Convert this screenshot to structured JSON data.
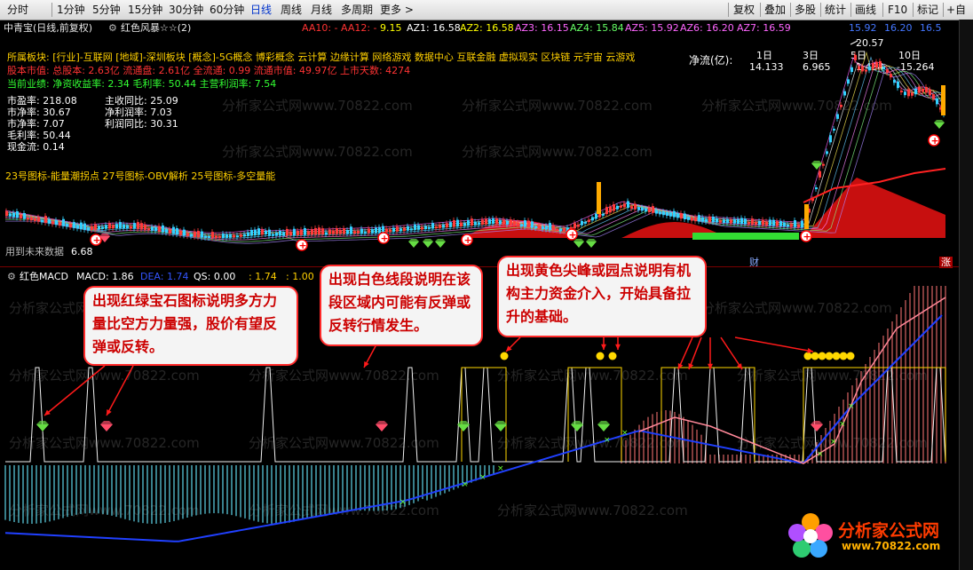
{
  "toolbar": {
    "left": [
      "分时",
      "1分钟",
      "5分钟",
      "15分钟",
      "30分钟",
      "60分钟",
      "日线",
      "周线",
      "月线",
      "多周期",
      "更多 >"
    ],
    "active": "日线",
    "right": [
      "复权",
      "叠加",
      "多股",
      "统计",
      "画线",
      "F10",
      "标记",
      "+自"
    ]
  },
  "title_line": {
    "stock": "中青宝(日线,前复权)",
    "indicator": "红色风暴☆☆(2)",
    "aa10": "AA10: -",
    "aa12": "AA12: -",
    "v915": "9.15",
    "az1": "AZ1: 16.58",
    "az2": "AZ2: 16.58",
    "az3": "AZ3: 16.15",
    "az4": "AZ4: 15.84",
    "az5": "AZ5: 15.92",
    "az6": "AZ6: 16.20",
    "az7": "AZ7: 16.59",
    "r1": "15.92",
    "r2": "16.20",
    "r3": "16.5"
  },
  "info": {
    "sector": "所属板块: [行业]-互联网 [地域]-深圳板块 [概念]-5G概念 博彩概念 云计算 边缘计算 网络游戏 数据中心 互联金融 虚拟现实 区块链 元宇宙 云游戏",
    "market": "股本市值: 总股本: 2.63亿 流通盘: 2.61亿 全流通: 0.99 流通市值: 49.97亿 上市天数: 4274",
    "perf": "当前业绩: 净资收益率: 2.34 毛利率: 50.44 主营利润率: 7.54",
    "left_stats": [
      "市盈率: 218.08",
      "市净率: 30.67",
      "市净率: 7.07",
      "毛利率: 50.44",
      "现金流: 0.14"
    ],
    "mid_stats": [
      "主收同比: 25.09",
      "净利润率: 7.03",
      "利润同比: 30.31"
    ],
    "netflow_label": "净流(亿):",
    "netflow_headers": [
      "1日",
      "3日",
      "5日",
      "10日"
    ],
    "netflow_values": [
      "14.133",
      "6.965",
      "1.434",
      "-15.264"
    ],
    "indicator_list": "23号图标-能量潮拐点 27号图标-OBV解析 25号图标-多空量能",
    "future_label": "用到未来数据",
    "low_price": "6.68",
    "high_price": "20.57",
    "badge_cai": "财",
    "badge_zhang": "涨"
  },
  "macd": {
    "label": "红色MACD",
    "macd": "MACD: 1.86",
    "dea": "DEA: 1.74",
    "qs": "QS: 0.00",
    "v1": ": 1.74",
    "v2": ": 1.00"
  },
  "annotations": [
    "出现红绿宝石图标说明多方力量比空方力量强，股价有望反弹或反转。",
    "出现白色线段说明在该段区域内可能有反弹或反转行情发生。",
    "出现黄色尖峰或园点说明有机构主力资金介入，开始具备拉升的基础。"
  ],
  "watermark": "分析家公式网www.70822.com",
  "logo": {
    "name": "分析家公式网",
    "url": "www.70822.com"
  },
  "colors": {
    "up": "#ff3b3b",
    "down": "#33d1ff",
    "macd_red": "#ff7777",
    "macd_cyan": "#5fd6e8",
    "dea": "#2040ff",
    "signal_white": "#f0f0f0",
    "yellow": "#ffd800",
    "gem_green": "#66dd44",
    "gem_red": "#ff4d6a",
    "annotation_text": "#cc0000"
  }
}
